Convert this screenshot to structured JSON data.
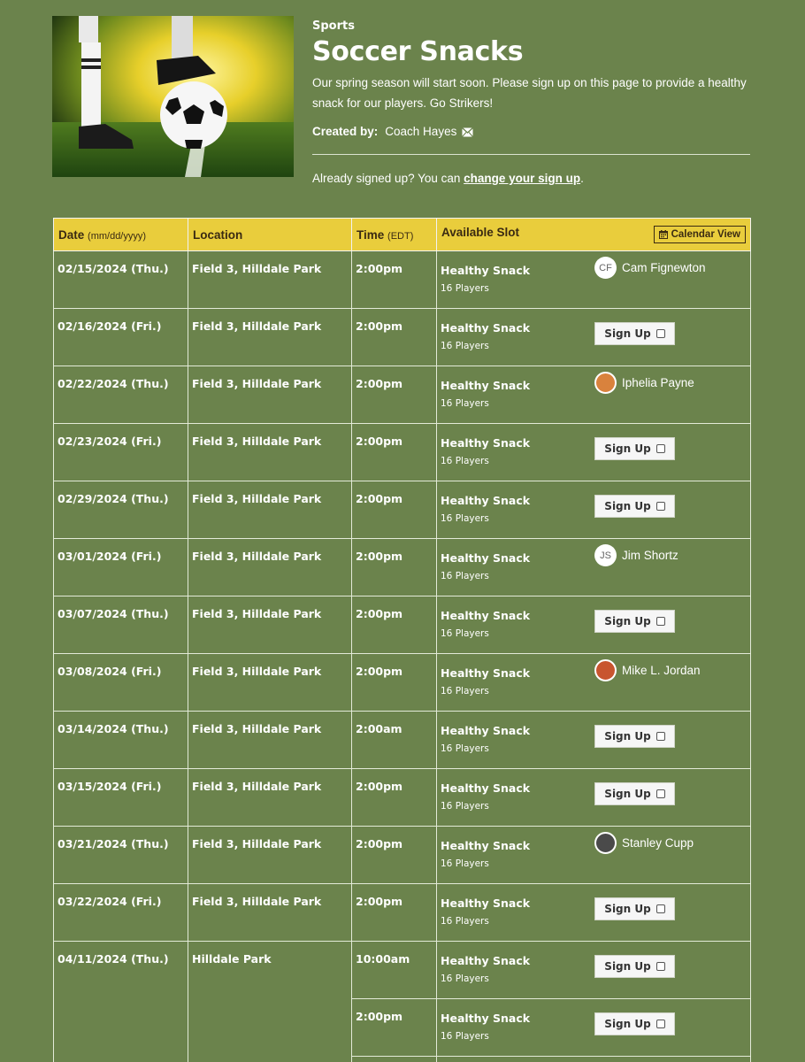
{
  "header": {
    "category": "Sports",
    "title": "Soccer Snacks",
    "description": "Our spring season will start soon. Please sign up on this page to provide a healthy snack for our players. Go Strikers!",
    "created_by_label": "Created by:",
    "creator": "Coach Hayes",
    "already_text": "Already signed up? You can ",
    "change_link": "change your sign up",
    "already_end": "."
  },
  "table": {
    "headers": {
      "date": "Date",
      "date_sub": "(mm/dd/yyyy)",
      "location": "Location",
      "time": "Time",
      "time_sub": "(EDT)",
      "slot": "Available Slot",
      "calendar_btn": "Calendar View"
    },
    "signup_label": "Sign Up",
    "rows": [
      {
        "date": "02/15/2024 (Thu.)",
        "location": "Field 3, Hilldale Park",
        "time": "2:00pm",
        "slot": "Healthy Snack",
        "qty": "16 Players",
        "taken_by": "Cam Fignewton",
        "avatar": "CF"
      },
      {
        "date": "02/16/2024 (Fri.)",
        "location": "Field 3, Hilldale Park",
        "time": "2:00pm",
        "slot": "Healthy Snack",
        "qty": "16 Players"
      },
      {
        "date": "02/22/2024 (Thu.)",
        "location": "Field 3, Hilldale Park",
        "time": "2:00pm",
        "slot": "Healthy Snack",
        "qty": "16 Players",
        "taken_by": "Iphelia Payne",
        "avatar_color": "#d9823d"
      },
      {
        "date": "02/23/2024 (Fri.)",
        "location": "Field 3, Hilldale Park",
        "time": "2:00pm",
        "slot": "Healthy Snack",
        "qty": "16 Players"
      },
      {
        "date": "02/29/2024 (Thu.)",
        "location": "Field 3, Hilldale Park",
        "time": "2:00pm",
        "slot": "Healthy Snack",
        "qty": "16 Players"
      },
      {
        "date": "03/01/2024 (Fri.)",
        "location": "Field 3, Hilldale Park",
        "time": "2:00pm",
        "slot": "Healthy Snack",
        "qty": "16 Players",
        "taken_by": "Jim Shortz",
        "avatar": "JS"
      },
      {
        "date": "03/07/2024 (Thu.)",
        "location": "Field 3, Hilldale Park",
        "time": "2:00pm",
        "slot": "Healthy Snack",
        "qty": "16 Players"
      },
      {
        "date": "03/08/2024 (Fri.)",
        "location": "Field 3, Hilldale Park",
        "time": "2:00pm",
        "slot": "Healthy Snack",
        "qty": "16 Players",
        "taken_by": "Mike L. Jordan",
        "avatar_color": "#c8552f"
      },
      {
        "date": "03/14/2024 (Thu.)",
        "location": "Field 3, Hilldale Park",
        "time": "2:00am",
        "slot": "Healthy Snack",
        "qty": "16 Players"
      },
      {
        "date": "03/15/2024 (Fri.)",
        "location": "Field 3, Hilldale Park",
        "time": "2:00pm",
        "slot": "Healthy Snack",
        "qty": "16 Players"
      },
      {
        "date": "03/21/2024 (Thu.)",
        "location": "Field 3, Hilldale Park",
        "time": "2:00pm",
        "slot": "Healthy Snack",
        "qty": "16 Players",
        "taken_by": "Stanley Cupp",
        "avatar_color": "#4a4a4a"
      },
      {
        "date": "03/22/2024 (Fri.)",
        "location": "Field 3, Hilldale Park",
        "time": "2:00pm",
        "slot": "Healthy Snack",
        "qty": "16 Players"
      }
    ],
    "group": {
      "date": "04/11/2024 (Thu.)",
      "location": "Hilldale Park",
      "times": [
        {
          "time": "10:00am",
          "slot": "Healthy Snack",
          "qty": "16 Players"
        },
        {
          "time": "2:00pm",
          "slot": "Healthy Snack",
          "qty": "16 Players"
        }
      ]
    }
  },
  "colors": {
    "background": "#6b834c",
    "header_row": "#e9cd3c",
    "header_text": "#3a2a12"
  }
}
